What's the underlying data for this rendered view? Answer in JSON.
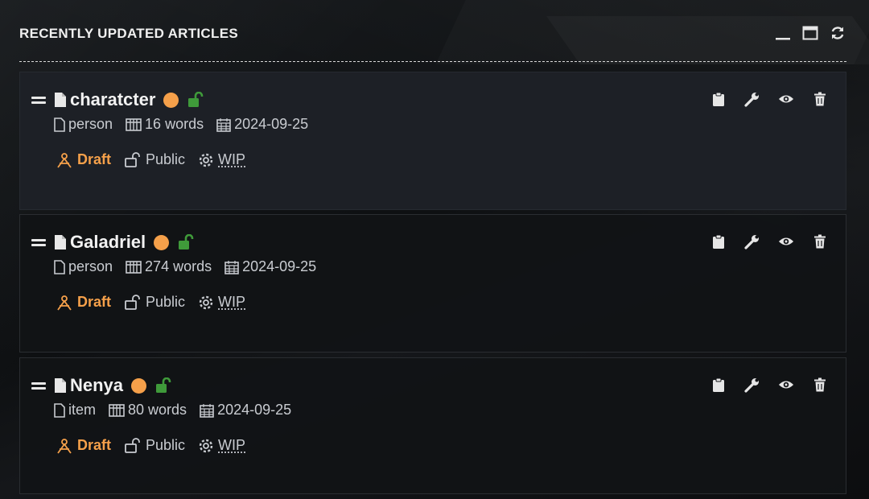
{
  "panel": {
    "title": "RECENTLY UPDATED ARTICLES"
  },
  "header_tools": [
    "minimize-icon",
    "maximize-icon",
    "refresh-icon"
  ],
  "colors": {
    "accent_orange": "#f5a04a",
    "unlocked_green": "#3f9a3a",
    "card_active_bg": "#1d2026"
  },
  "articles": [
    {
      "title": "charatcter",
      "type": "person",
      "words": "16 words",
      "date": "2024-09-25",
      "status": "Draft",
      "visibility": "Public",
      "progress": "WIP"
    },
    {
      "title": "Galadriel",
      "type": "person",
      "words": "274 words",
      "date": "2024-09-25",
      "status": "Draft",
      "visibility": "Public",
      "progress": "WIP"
    },
    {
      "title": "Nenya",
      "type": "item",
      "words": "80 words",
      "date": "2024-09-25",
      "status": "Draft",
      "visibility": "Public",
      "progress": "WIP"
    }
  ],
  "card_actions": [
    "clipboard-icon",
    "wrench-icon",
    "eye-icon",
    "trash-icon"
  ]
}
